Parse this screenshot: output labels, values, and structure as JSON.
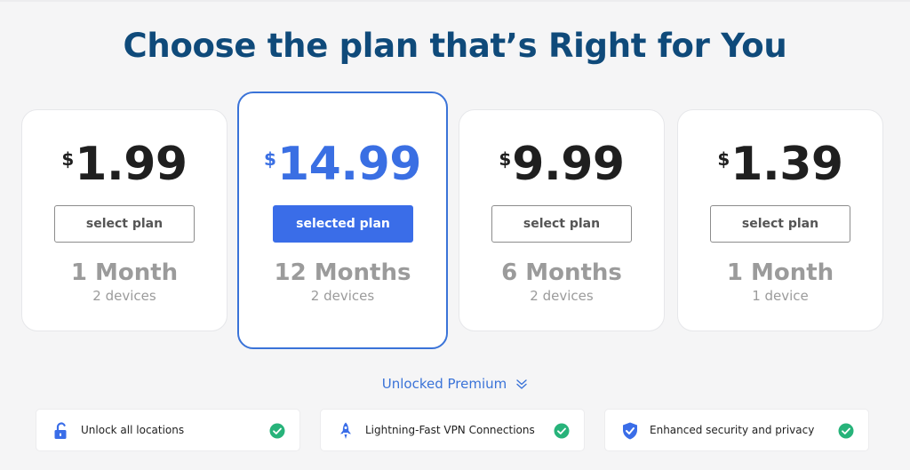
{
  "title": "Choose the plan that’s Right for You",
  "currency_symbol": "$",
  "plans": [
    {
      "price": "1.99",
      "button_label": "select plan",
      "duration": "1 Month",
      "devices": "2 devices",
      "selected": false
    },
    {
      "price": "14.99",
      "button_label": "selected plan",
      "duration": "12 Months",
      "devices": "2 devices",
      "selected": true
    },
    {
      "price": "9.99",
      "button_label": "select plan",
      "duration": "6 Months",
      "devices": "2 devices",
      "selected": false
    },
    {
      "price": "1.39",
      "button_label": "select plan",
      "duration": "1 Month",
      "devices": "1 device",
      "selected": false
    }
  ],
  "unlocked_premium": {
    "label": "Unlocked Premium",
    "icon": "chevron-double-down-icon"
  },
  "features": [
    {
      "label": "Unlock all locations",
      "icon": "unlock-icon",
      "status_icon": "check-circle-icon"
    },
    {
      "label": "Lightning-Fast VPN Connections",
      "icon": "rocket-icon",
      "status_icon": "check-circle-icon"
    },
    {
      "label": "Enhanced security and privacy",
      "icon": "shield-check-icon",
      "status_icon": "check-circle-icon"
    }
  ],
  "colors": {
    "title": "#0f4a7a",
    "accent": "#3a6de8",
    "selected_border": "#3a73d8",
    "muted": "#9b9b9b",
    "check": "#27b37a"
  }
}
